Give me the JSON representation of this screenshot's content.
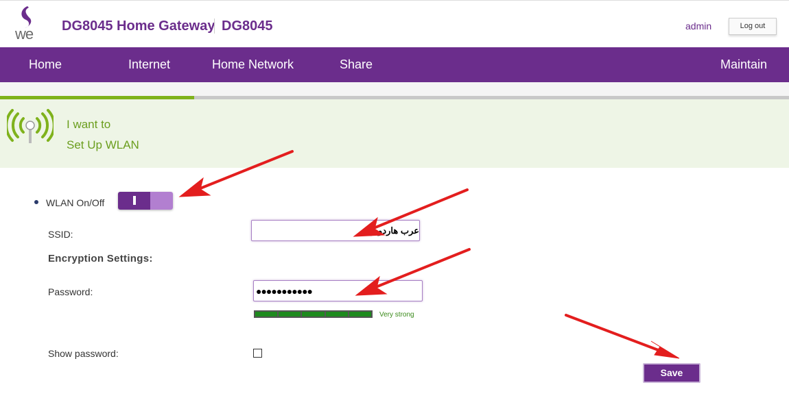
{
  "header": {
    "logo_text": "we",
    "title": "DG8045 Home Gateway",
    "model": "DG8045",
    "user": "admin",
    "logout_label": "Log out"
  },
  "nav": {
    "items": [
      {
        "label": "Home"
      },
      {
        "label": "Internet"
      },
      {
        "label": "Home Network"
      },
      {
        "label": "Share"
      },
      {
        "label": "Maintain"
      }
    ]
  },
  "wizard": {
    "progress_fraction": 0.246,
    "line1": "I want to",
    "line2": "Set Up WLAN",
    "icon": "wifi-signal-icon"
  },
  "form": {
    "wlan_label": "WLAN On/Off",
    "wlan_state": "on",
    "ssid_label": "SSID:",
    "ssid_value": "عرب هاردوير",
    "encryption_title": "Encryption Settings:",
    "password_label": "Password:",
    "password_value": "●●●●●●●●●●●",
    "strength_label": "Very strong",
    "strength_level": 5,
    "show_password_label": "Show password:",
    "show_password_checked": false,
    "save_label": "Save"
  },
  "colors": {
    "brand_purple": "#6b2d8c",
    "wizard_green": "#7fb21c",
    "strength_green": "#1e8a1e",
    "arrow_red": "#e31e1e"
  }
}
